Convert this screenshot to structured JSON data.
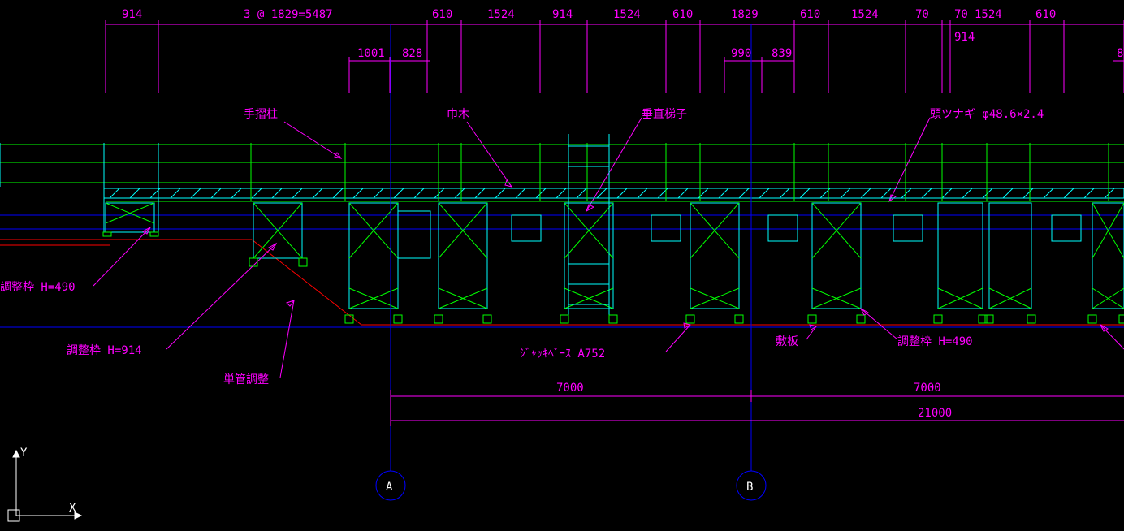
{
  "dimensions_top": {
    "d1": "914",
    "d2": "3 @ 1829=5487",
    "d3": "610",
    "d4": "1524",
    "d5": "914",
    "d6": "1524",
    "d7": "610",
    "d8": "1829",
    "d9": "610",
    "d10": "1524",
    "d11": "70",
    "d12": "70",
    "d13": "1524",
    "d14": "610",
    "d15": "914"
  },
  "dimensions_sub": {
    "s1": "1001",
    "s2": "828",
    "s3": "990",
    "s4": "839",
    "s5": "8"
  },
  "labels": {
    "l1": "手摺柱",
    "l2": "巾木",
    "l3": "垂直梯子",
    "l4": "頭ツナギ φ48.6×2.4",
    "l5": "調整枠 H=490",
    "l6": "調整枠 H=914",
    "l7": "単管調整",
    "l8": "ｼﾞｬｯｷﾍﾞｰｽ A752",
    "l9": "敷板",
    "l10": "調整枠 H=490"
  },
  "bottom_dims": {
    "b1": "7000",
    "b2": "7000",
    "b3": "21000"
  },
  "grids": {
    "gA": "A",
    "gB": "B"
  },
  "ucs": {
    "x": "X",
    "y": "Y"
  }
}
